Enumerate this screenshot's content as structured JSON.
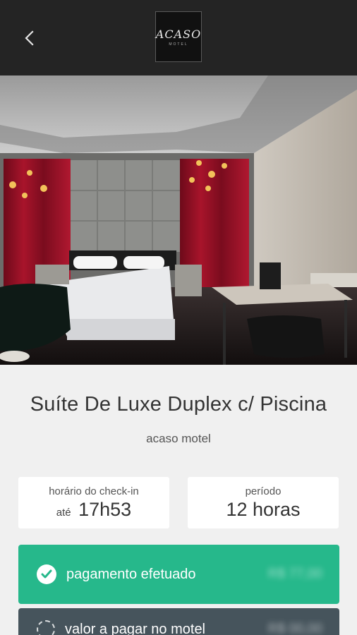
{
  "header": {
    "logo_text": "ACASO",
    "logo_sub": "MOTEL",
    "back_icon": "chevron-left-icon"
  },
  "suite": {
    "name": "Suíte De Luxe Duplex c/ Piscina",
    "motel": "acaso motel"
  },
  "checkin": {
    "label": "horário do check-in",
    "prefix": "até",
    "time": "17h53"
  },
  "period": {
    "label": "período",
    "value": "12 horas"
  },
  "payments": {
    "paid_label": "pagamento efetuado",
    "paid_amount": "R$ 77,00",
    "due_label": "valor a pagar no motel",
    "due_amount": "R$ 00,00"
  },
  "colors": {
    "topbar": "#242424",
    "paid": "#26b88b",
    "due": "#46545c"
  }
}
